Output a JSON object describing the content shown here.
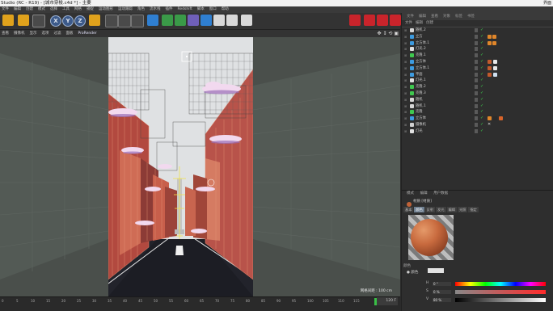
{
  "window": {
    "title": "Studio (RC - R19) - [城市穿梭.c4d *] - 主要",
    "right_label": "界面"
  },
  "menu": [
    "文件",
    "编辑",
    "创建",
    "模式",
    "选择",
    "工具",
    "网格",
    "捕捉",
    "运动图形",
    "运动跟踪",
    "角色",
    "流水线",
    "插件",
    "Redshift",
    "脚本",
    "窗口",
    "帮助"
  ],
  "toolbar": {
    "axis_x": "X",
    "axis_y": "Y",
    "axis_z": "Z"
  },
  "viewport_menu": {
    "items": [
      "查看",
      "摄像机",
      "显示",
      "选项",
      "过滤",
      "面板"
    ],
    "renderer": "ProRender",
    "nav_icons": "✥ ↕ ⟲ ▣"
  },
  "viewport": {
    "status": "网格间距 : 100 cm"
  },
  "timeline": {
    "ticks": [
      "0",
      "5",
      "10",
      "15",
      "20",
      "25",
      "30",
      "35",
      "40",
      "45",
      "50",
      "55",
      "60",
      "65",
      "70",
      "75",
      "80",
      "85",
      "90",
      "95",
      "100",
      "105",
      "110",
      "115"
    ],
    "frame_value": "120 F"
  },
  "object_panel": {
    "tabs": [
      {
        "label": "文件",
        "active": false
      },
      {
        "label": "编辑",
        "active": false
      },
      {
        "label": "查看",
        "active": false
      },
      {
        "label": "对象",
        "active": false
      },
      {
        "label": "标签",
        "active": false
      },
      {
        "label": "书签",
        "active": false
      }
    ],
    "objects": [
      {
        "name": "随机.2",
        "color": "#d6d6d6",
        "tag": "none"
      },
      {
        "name": "立方",
        "color": "#3d9be0",
        "tag": "orange"
      },
      {
        "name": "立方体.1",
        "color": "#3d9be0",
        "tag": "orange"
      },
      {
        "name": "灯光.2",
        "color": "#e0e0e0",
        "tag": "none"
      },
      {
        "name": "克隆.1",
        "color": "#3fc84f",
        "tag": "none"
      },
      {
        "name": "立方体",
        "color": "#3d9be0",
        "tag": "material"
      },
      {
        "name": "立方体.1",
        "color": "#3d9be0",
        "tag": "material"
      },
      {
        "name": "平面",
        "color": "#3d9be0",
        "tag": "material2"
      },
      {
        "name": "灯光.1",
        "color": "#e0e0e0",
        "tag": "none"
      },
      {
        "name": "克隆.2",
        "color": "#3fc84f",
        "tag": "none"
      },
      {
        "name": "克隆.3",
        "color": "#3fc84f",
        "tag": "none"
      },
      {
        "name": "随机",
        "color": "#d6d6d6",
        "tag": "none"
      },
      {
        "name": "随机.1",
        "color": "#d6d6d6",
        "tag": "none"
      },
      {
        "name": "克隆",
        "color": "#3fc84f",
        "tag": "none"
      },
      {
        "name": "立方体",
        "color": "#3d9be0",
        "tag": "multi"
      },
      {
        "name": "摄像机",
        "color": "#d0d0d0",
        "tag": "x"
      },
      {
        "name": "灯光",
        "color": "#e0e0e0",
        "tag": "none"
      }
    ]
  },
  "attribute_panel": {
    "tabs": [
      "模式",
      "编辑",
      "用户数据"
    ],
    "material_name": "材质 [材质]",
    "channels": [
      {
        "label": "基本",
        "active": false
      },
      {
        "label": "颜色",
        "active": true
      },
      {
        "label": "反射",
        "active": false
      },
      {
        "label": "发光",
        "active": false
      },
      {
        "label": "编辑",
        "active": false
      },
      {
        "label": "光照",
        "active": false
      },
      {
        "label": "指定",
        "active": false
      }
    ],
    "color_section": "颜色",
    "color_row_label": "● 颜色",
    "H": {
      "label": "H",
      "value": "0 °"
    },
    "S": {
      "label": "S",
      "value": "0 %"
    },
    "V": {
      "label": "V",
      "value": "80 %"
    }
  }
}
